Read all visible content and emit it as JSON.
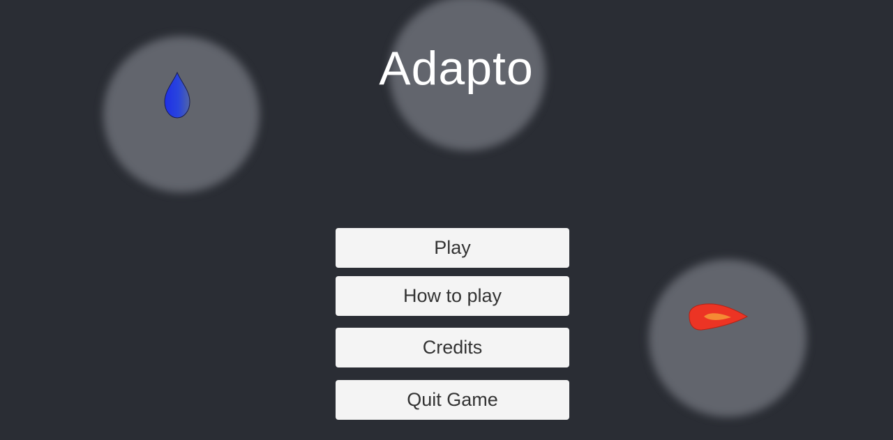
{
  "game": {
    "title": "Adapto"
  },
  "menu": {
    "play_label": "Play",
    "how_to_play_label": "How to play",
    "credits_label": "Credits",
    "quit_label": "Quit Game"
  },
  "sprites": {
    "water_drop_icon": "water-drop-icon",
    "fire_icon": "fire-icon"
  },
  "colors": {
    "background": "#2a2d34",
    "glow": "#62656d",
    "button_background": "#f4f4f4",
    "button_text": "#333333",
    "title_text": "#ffffff",
    "water_blue": "#1f3ee6",
    "fire_red": "#e83222",
    "fire_orange": "#f47a26"
  }
}
